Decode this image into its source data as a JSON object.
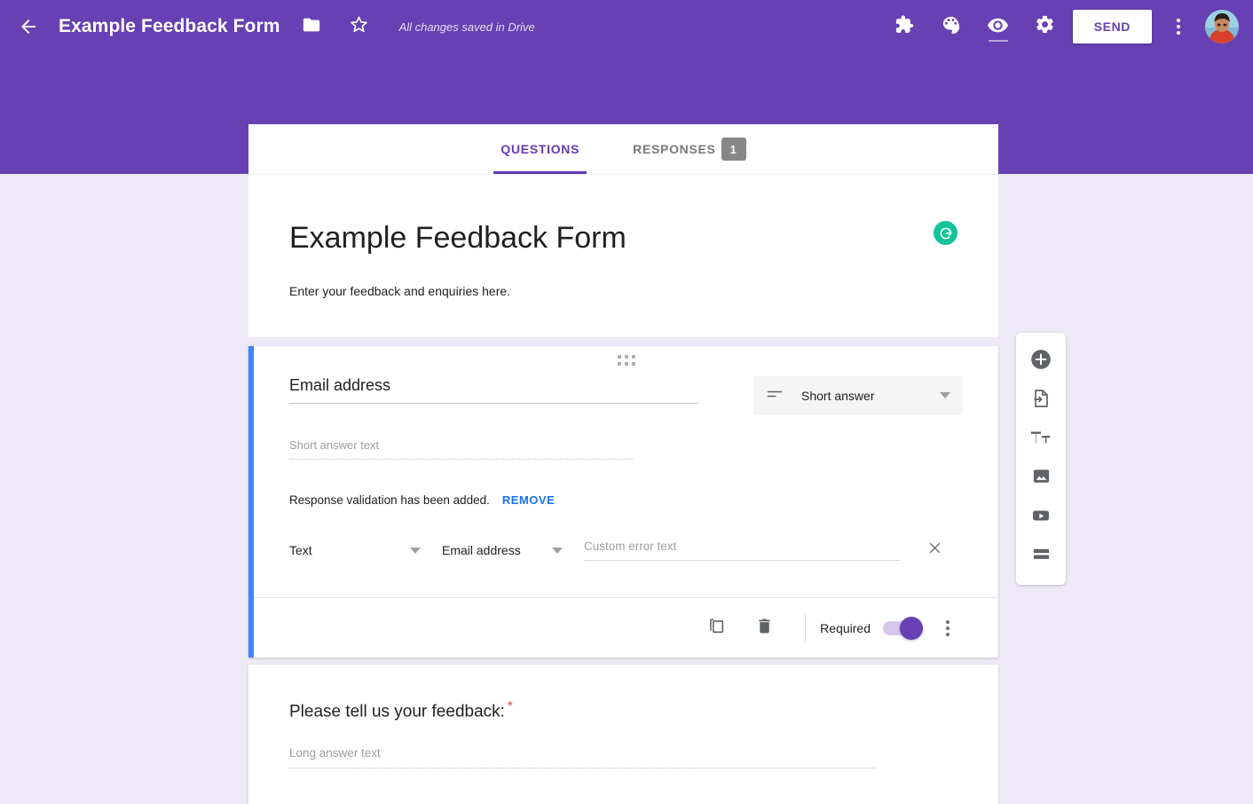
{
  "topbar": {
    "back_icon": "back-arrow-icon",
    "title": "Example Feedback Form",
    "folder_icon": "folder-icon",
    "star_icon": "star-icon",
    "save_status": "All changes saved in Drive",
    "addons_icon": "puzzle-piece-icon",
    "theme_icon": "palette-icon",
    "preview_icon": "eye-icon",
    "settings_icon": "gear-icon",
    "send_label": "SEND",
    "more_icon": "more-vertical-icon",
    "avatar_icon": "user-avatar",
    "bg_color": "#6741b3"
  },
  "tabs": [
    {
      "label": "QUESTIONS",
      "active": true,
      "badge": null
    },
    {
      "label": "RESPONSES",
      "active": false,
      "badge": "1"
    }
  ],
  "form_header": {
    "title": "Example Feedback Form",
    "description": "Enter your feedback and enquiries here.",
    "grammarly_icon": "grammarly-icon",
    "grammarly_glyph": "G",
    "grammarly_color": "#15c39a"
  },
  "question_1": {
    "drag_handle_icon": "drag-handle-icon",
    "title": "Email address",
    "type_icon": "short-answer-icon",
    "type_label": "Short answer",
    "type_dropdown_icon": "chevron-down-icon",
    "answer_placeholder": "Short answer text",
    "validation_note": "Response validation has been added.",
    "remove_label": "REMOVE",
    "validation": {
      "rule_type": "Text",
      "rule_condition": "Email address",
      "error_placeholder": "Custom error text",
      "close_icon": "close-icon",
      "dropdown_icon": "chevron-down-icon"
    },
    "footer": {
      "duplicate_icon": "duplicate-icon",
      "delete_icon": "trash-icon",
      "required_label": "Required",
      "required_on": true,
      "toggle_color": "#6741b3",
      "more_icon": "more-vertical-icon"
    },
    "accent_color": "#4285f4"
  },
  "question_2": {
    "title": "Please tell us your feedback:",
    "required_marker": "*",
    "answer_placeholder": "Long answer text"
  },
  "right_toolbar": [
    {
      "icon": "add-question-icon",
      "label": "Add question"
    },
    {
      "icon": "import-questions-icon",
      "label": "Import questions"
    },
    {
      "icon": "add-title-description-icon",
      "label": "Add title and description"
    },
    {
      "icon": "add-image-icon",
      "label": "Add image"
    },
    {
      "icon": "add-video-icon",
      "label": "Add video"
    },
    {
      "icon": "add-section-icon",
      "label": "Add section"
    }
  ]
}
